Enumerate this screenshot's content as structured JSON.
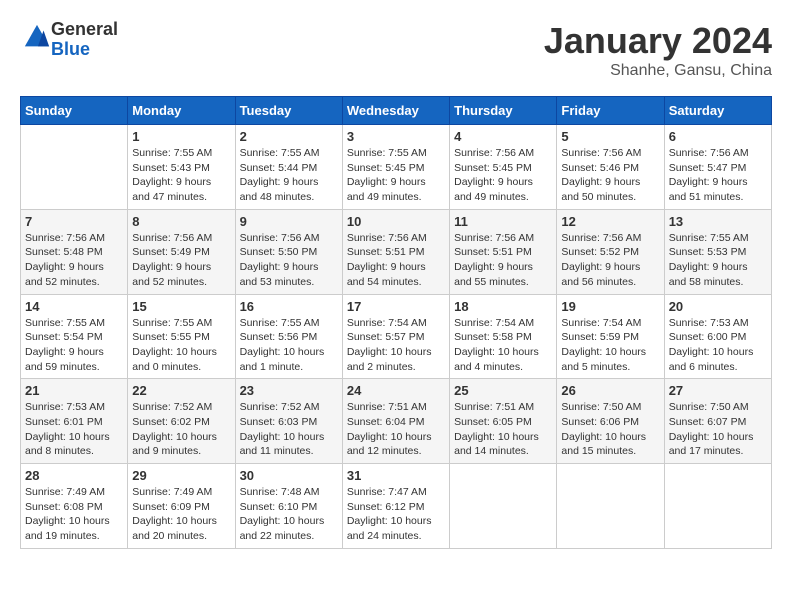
{
  "header": {
    "logo_line1": "General",
    "logo_line2": "Blue",
    "month": "January 2024",
    "location": "Shanhe, Gansu, China"
  },
  "weekdays": [
    "Sunday",
    "Monday",
    "Tuesday",
    "Wednesday",
    "Thursday",
    "Friday",
    "Saturday"
  ],
  "weeks": [
    [
      {
        "day": "",
        "sunrise": "",
        "sunset": "",
        "daylight": ""
      },
      {
        "day": "1",
        "sunrise": "Sunrise: 7:55 AM",
        "sunset": "Sunset: 5:43 PM",
        "daylight": "Daylight: 9 hours and 47 minutes."
      },
      {
        "day": "2",
        "sunrise": "Sunrise: 7:55 AM",
        "sunset": "Sunset: 5:44 PM",
        "daylight": "Daylight: 9 hours and 48 minutes."
      },
      {
        "day": "3",
        "sunrise": "Sunrise: 7:55 AM",
        "sunset": "Sunset: 5:45 PM",
        "daylight": "Daylight: 9 hours and 49 minutes."
      },
      {
        "day": "4",
        "sunrise": "Sunrise: 7:56 AM",
        "sunset": "Sunset: 5:45 PM",
        "daylight": "Daylight: 9 hours and 49 minutes."
      },
      {
        "day": "5",
        "sunrise": "Sunrise: 7:56 AM",
        "sunset": "Sunset: 5:46 PM",
        "daylight": "Daylight: 9 hours and 50 minutes."
      },
      {
        "day": "6",
        "sunrise": "Sunrise: 7:56 AM",
        "sunset": "Sunset: 5:47 PM",
        "daylight": "Daylight: 9 hours and 51 minutes."
      }
    ],
    [
      {
        "day": "7",
        "sunrise": "Sunrise: 7:56 AM",
        "sunset": "Sunset: 5:48 PM",
        "daylight": "Daylight: 9 hours and 52 minutes."
      },
      {
        "day": "8",
        "sunrise": "Sunrise: 7:56 AM",
        "sunset": "Sunset: 5:49 PM",
        "daylight": "Daylight: 9 hours and 52 minutes."
      },
      {
        "day": "9",
        "sunrise": "Sunrise: 7:56 AM",
        "sunset": "Sunset: 5:50 PM",
        "daylight": "Daylight: 9 hours and 53 minutes."
      },
      {
        "day": "10",
        "sunrise": "Sunrise: 7:56 AM",
        "sunset": "Sunset: 5:51 PM",
        "daylight": "Daylight: 9 hours and 54 minutes."
      },
      {
        "day": "11",
        "sunrise": "Sunrise: 7:56 AM",
        "sunset": "Sunset: 5:51 PM",
        "daylight": "Daylight: 9 hours and 55 minutes."
      },
      {
        "day": "12",
        "sunrise": "Sunrise: 7:56 AM",
        "sunset": "Sunset: 5:52 PM",
        "daylight": "Daylight: 9 hours and 56 minutes."
      },
      {
        "day": "13",
        "sunrise": "Sunrise: 7:55 AM",
        "sunset": "Sunset: 5:53 PM",
        "daylight": "Daylight: 9 hours and 58 minutes."
      }
    ],
    [
      {
        "day": "14",
        "sunrise": "Sunrise: 7:55 AM",
        "sunset": "Sunset: 5:54 PM",
        "daylight": "Daylight: 9 hours and 59 minutes."
      },
      {
        "day": "15",
        "sunrise": "Sunrise: 7:55 AM",
        "sunset": "Sunset: 5:55 PM",
        "daylight": "Daylight: 10 hours and 0 minutes."
      },
      {
        "day": "16",
        "sunrise": "Sunrise: 7:55 AM",
        "sunset": "Sunset: 5:56 PM",
        "daylight": "Daylight: 10 hours and 1 minute."
      },
      {
        "day": "17",
        "sunrise": "Sunrise: 7:54 AM",
        "sunset": "Sunset: 5:57 PM",
        "daylight": "Daylight: 10 hours and 2 minutes."
      },
      {
        "day": "18",
        "sunrise": "Sunrise: 7:54 AM",
        "sunset": "Sunset: 5:58 PM",
        "daylight": "Daylight: 10 hours and 4 minutes."
      },
      {
        "day": "19",
        "sunrise": "Sunrise: 7:54 AM",
        "sunset": "Sunset: 5:59 PM",
        "daylight": "Daylight: 10 hours and 5 minutes."
      },
      {
        "day": "20",
        "sunrise": "Sunrise: 7:53 AM",
        "sunset": "Sunset: 6:00 PM",
        "daylight": "Daylight: 10 hours and 6 minutes."
      }
    ],
    [
      {
        "day": "21",
        "sunrise": "Sunrise: 7:53 AM",
        "sunset": "Sunset: 6:01 PM",
        "daylight": "Daylight: 10 hours and 8 minutes."
      },
      {
        "day": "22",
        "sunrise": "Sunrise: 7:52 AM",
        "sunset": "Sunset: 6:02 PM",
        "daylight": "Daylight: 10 hours and 9 minutes."
      },
      {
        "day": "23",
        "sunrise": "Sunrise: 7:52 AM",
        "sunset": "Sunset: 6:03 PM",
        "daylight": "Daylight: 10 hours and 11 minutes."
      },
      {
        "day": "24",
        "sunrise": "Sunrise: 7:51 AM",
        "sunset": "Sunset: 6:04 PM",
        "daylight": "Daylight: 10 hours and 12 minutes."
      },
      {
        "day": "25",
        "sunrise": "Sunrise: 7:51 AM",
        "sunset": "Sunset: 6:05 PM",
        "daylight": "Daylight: 10 hours and 14 minutes."
      },
      {
        "day": "26",
        "sunrise": "Sunrise: 7:50 AM",
        "sunset": "Sunset: 6:06 PM",
        "daylight": "Daylight: 10 hours and 15 minutes."
      },
      {
        "day": "27",
        "sunrise": "Sunrise: 7:50 AM",
        "sunset": "Sunset: 6:07 PM",
        "daylight": "Daylight: 10 hours and 17 minutes."
      }
    ],
    [
      {
        "day": "28",
        "sunrise": "Sunrise: 7:49 AM",
        "sunset": "Sunset: 6:08 PM",
        "daylight": "Daylight: 10 hours and 19 minutes."
      },
      {
        "day": "29",
        "sunrise": "Sunrise: 7:49 AM",
        "sunset": "Sunset: 6:09 PM",
        "daylight": "Daylight: 10 hours and 20 minutes."
      },
      {
        "day": "30",
        "sunrise": "Sunrise: 7:48 AM",
        "sunset": "Sunset: 6:10 PM",
        "daylight": "Daylight: 10 hours and 22 minutes."
      },
      {
        "day": "31",
        "sunrise": "Sunrise: 7:47 AM",
        "sunset": "Sunset: 6:12 PM",
        "daylight": "Daylight: 10 hours and 24 minutes."
      },
      {
        "day": "",
        "sunrise": "",
        "sunset": "",
        "daylight": ""
      },
      {
        "day": "",
        "sunrise": "",
        "sunset": "",
        "daylight": ""
      },
      {
        "day": "",
        "sunrise": "",
        "sunset": "",
        "daylight": ""
      }
    ]
  ]
}
